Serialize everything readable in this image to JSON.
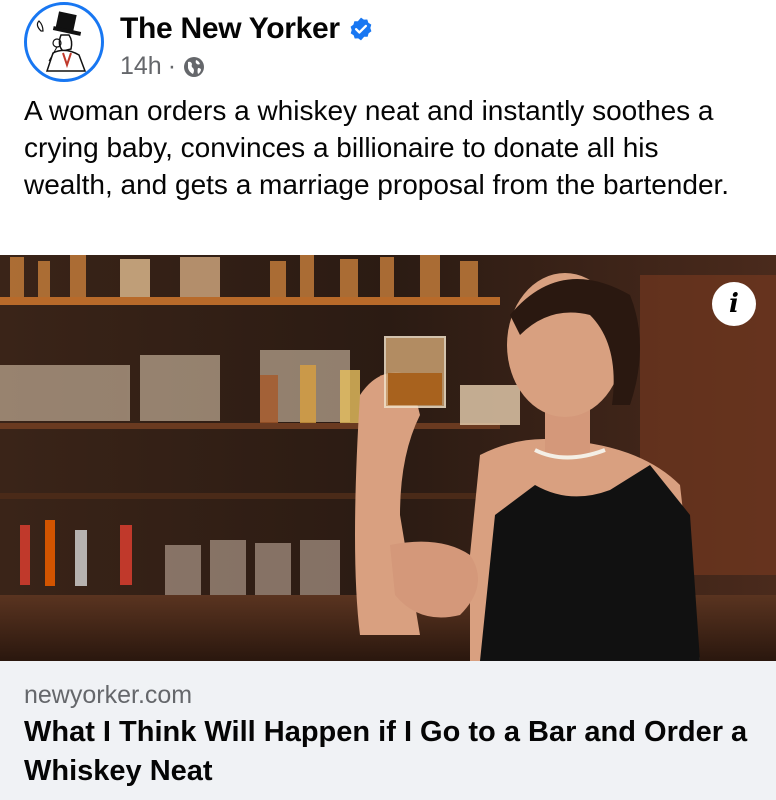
{
  "post": {
    "page_name": "The New Yorker",
    "verified_icon": "verified-badge-icon",
    "time": "14h",
    "separator": "·",
    "audience_icon": "globe-icon",
    "text": "A woman orders a whiskey neat and instantly soothes a crying baby, convinces a billionaire to donate all his wealth, and gets a marriage proposal from the bartender."
  },
  "image": {
    "description_icon": "info-icon",
    "info_label": "i"
  },
  "link": {
    "domain": "newyorker.com",
    "title": "What I Think Will Happen if I Go to a Bar and Order a Whiskey Neat"
  },
  "colors": {
    "accent": "#1877f2",
    "text": "#050505",
    "secondary_text": "#65676b",
    "link_card_bg": "#f0f2f5"
  }
}
